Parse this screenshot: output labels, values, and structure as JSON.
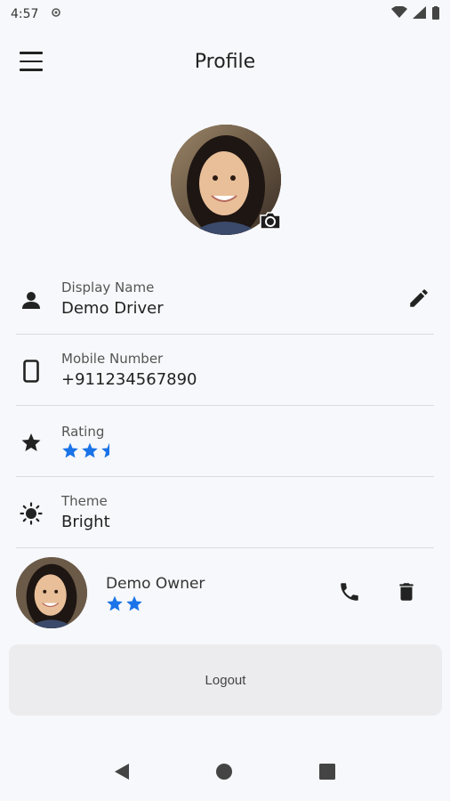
{
  "status_bar": {
    "time": "4:57"
  },
  "app_bar": {
    "title": "Profile"
  },
  "profile": {
    "fields": [
      {
        "label": "Display Name",
        "value": "Demo Driver",
        "icon": "person-icon"
      },
      {
        "label": "Mobile Number",
        "value": "+911234567890",
        "icon": "phone-device-icon"
      },
      {
        "label": "Rating",
        "rating": 2.5,
        "max": 5,
        "icon": "star-icon"
      },
      {
        "label": "Theme",
        "value": "Bright",
        "icon": "brightness-icon"
      }
    ]
  },
  "owner": {
    "name": "Demo Owner",
    "rating": 2
  },
  "logout_label": "Logout",
  "colors": {
    "accent": "#1a73e8",
    "background": "#f7f8fb",
    "button": "#ececef"
  }
}
